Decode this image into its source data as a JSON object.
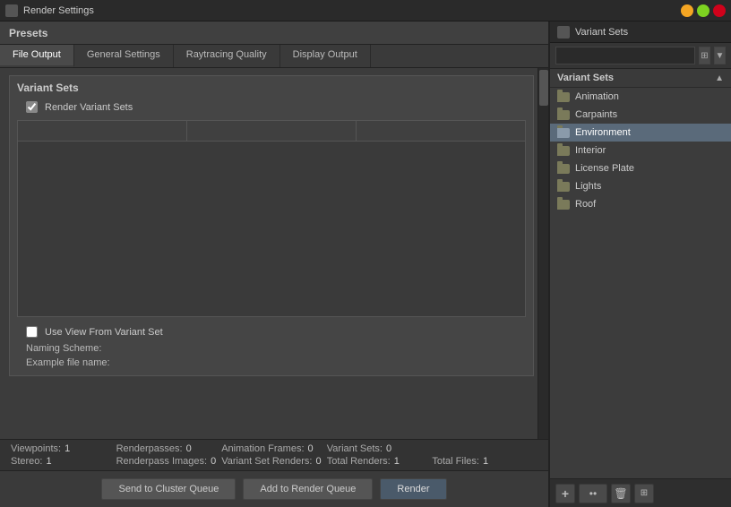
{
  "titleBar": {
    "icon": "render-icon",
    "title": "Render Settings"
  },
  "presets": {
    "label": "Presets"
  },
  "tabs": [
    {
      "id": "file-output",
      "label": "File Output",
      "active": true
    },
    {
      "id": "general-settings",
      "label": "General Settings",
      "active": false
    },
    {
      "id": "raytracing-quality",
      "label": "Raytracing Quality",
      "active": false
    },
    {
      "id": "display-output",
      "label": "Display Output",
      "active": false
    }
  ],
  "mainSection": {
    "title": "Variant Sets",
    "checkbox": {
      "label": "Render Variant Sets",
      "checked": true
    },
    "useViewCheckbox": {
      "label": "Use View From Variant Set",
      "checked": false
    },
    "naming": {
      "scheme_label": "Naming Scheme:",
      "example_label": "Example file name:"
    }
  },
  "statusBar": {
    "viewpoints_label": "Viewpoints:",
    "viewpoints_val": "1",
    "renderpasses_label": "Renderpasses:",
    "renderpasses_val": "0",
    "animation_label": "Animation Frames:",
    "animation_val": "0",
    "variant_sets_label": "Variant Sets:",
    "variant_sets_val": "0",
    "total_renders_label": "Total Renders:",
    "total_renders_val": "1",
    "stereo_label": "Stereo:",
    "stereo_val": "1",
    "renderpass_images_label": "Renderpass Images:",
    "renderpass_images_val": "0",
    "variant_set_renders_label": "Variant Set Renders:",
    "variant_set_renders_val": "0",
    "total_files_label": "Total Files:",
    "total_files_val": "1"
  },
  "buttons": {
    "send_to_cluster": "Send to Cluster Queue",
    "add_to_render": "Add to Render Queue",
    "render": "Render"
  },
  "rightPanel": {
    "title": "Variant Sets",
    "search": {
      "placeholder": ""
    },
    "treeHeader": "Variant Sets",
    "items": [
      {
        "label": "Animation",
        "selected": false
      },
      {
        "label": "Carpaints",
        "selected": false
      },
      {
        "label": "Environment",
        "selected": true
      },
      {
        "label": "Interior",
        "selected": false
      },
      {
        "label": "License Plate",
        "selected": false
      },
      {
        "label": "Lights",
        "selected": false
      },
      {
        "label": "Roof",
        "selected": false
      }
    ]
  }
}
